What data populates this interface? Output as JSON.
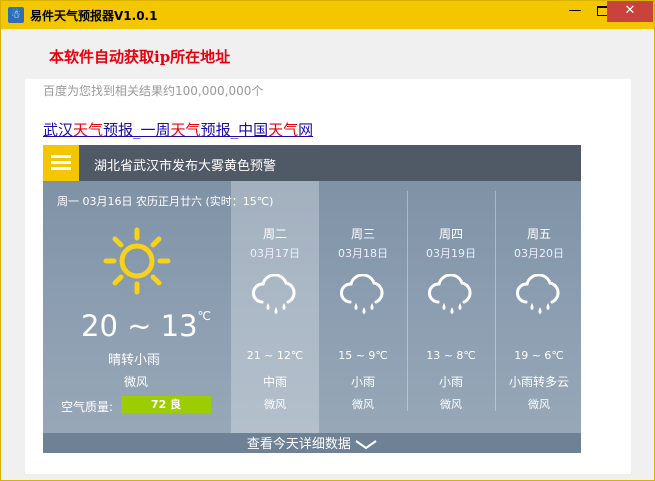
{
  "window": {
    "title": "易件天气预报器V1.0.1",
    "min_glyph": "—",
    "close_glyph": "✕",
    "icon_glyph": "☃"
  },
  "headline": "本软件自动获取ip所在地址",
  "search": {
    "result_count": "百度为您找到相关结果约100,000,000个",
    "result_link": {
      "p1": "武汉",
      "h1": "天气",
      "p2": "预报_一周",
      "h2": "天气",
      "p3": "预报_中国",
      "h3": "天气",
      "p4": "网"
    }
  },
  "weather": {
    "alert": "湖北省武汉市发布大雾黄色预警",
    "today": {
      "date_line": "周一 03月16日 农历正月廿六 (实时：15℃)",
      "temp_range": "20 ~ 13",
      "unit": "℃",
      "weather": "晴转小雨",
      "wind": "微风",
      "aqi_label": "空气质量:",
      "aqi_value": "72 良",
      "icon": "sun-icon"
    },
    "forecast": [
      {
        "name": "周二",
        "date": "03月17日",
        "temp": "21 ~ 12℃",
        "weather": "中雨",
        "wind": "微风",
        "icon": "rain-cloud-icon"
      },
      {
        "name": "周三",
        "date": "03月18日",
        "temp": "15 ~ 9℃",
        "weather": "小雨",
        "wind": "微风",
        "icon": "rain-cloud-icon"
      },
      {
        "name": "周四",
        "date": "03月19日",
        "temp": "13 ~ 8℃",
        "weather": "小雨",
        "wind": "微风",
        "icon": "rain-cloud-icon"
      },
      {
        "name": "周五",
        "date": "03月20日",
        "temp": "19 ~ 6℃",
        "weather": "小雨转多云",
        "wind": "微风",
        "icon": "rain-cloud-icon"
      }
    ],
    "more_label": "查看今天详细数据",
    "colors": {
      "accent": "#f3c600",
      "aqi_good": "#9ccd00",
      "alert_bar": "#505a66"
    }
  }
}
